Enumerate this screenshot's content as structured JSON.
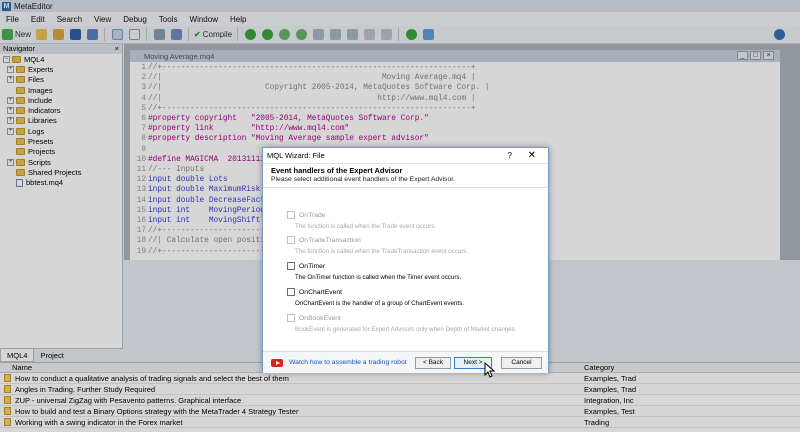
{
  "app": {
    "title": "MetaEditor"
  },
  "menu": [
    "File",
    "Edit",
    "Search",
    "View",
    "Debug",
    "Tools",
    "Window",
    "Help"
  ],
  "toolbar": {
    "new_label": "New",
    "compile_label": "Compile"
  },
  "navigator": {
    "title": "Navigator",
    "root": "MQL4",
    "items": [
      {
        "label": "Experts",
        "type": "folder",
        "expandable": true
      },
      {
        "label": "Files",
        "type": "folder",
        "expandable": true
      },
      {
        "label": "Images",
        "type": "folder",
        "expandable": false
      },
      {
        "label": "Include",
        "type": "folder",
        "expandable": true
      },
      {
        "label": "Indicators",
        "type": "folder",
        "expandable": true
      },
      {
        "label": "Libraries",
        "type": "folder",
        "expandable": true
      },
      {
        "label": "Logs",
        "type": "folder",
        "expandable": true
      },
      {
        "label": "Presets",
        "type": "folder",
        "expandable": false
      },
      {
        "label": "Projects",
        "type": "folder",
        "expandable": false
      },
      {
        "label": "Scripts",
        "type": "folder",
        "expandable": true
      },
      {
        "label": "Shared Projects",
        "type": "folder",
        "expandable": false
      },
      {
        "label": "bbtest.mq4",
        "type": "file",
        "expandable": false
      }
    ],
    "tabs": [
      "MQL4",
      "Project"
    ]
  },
  "editor": {
    "tab_title": "Moving Average.mq4",
    "lines": [
      {
        "n": "1",
        "t": "//+------------------------------------------------------------------+",
        "c": "cm"
      },
      {
        "n": "2",
        "t": "//|                                               Moving Average.mq4 |",
        "c": "cm"
      },
      {
        "n": "3",
        "t": "//|                      Copyright 2005-2014, MetaQuotes Software Corp. |",
        "c": "cm"
      },
      {
        "n": "4",
        "t": "//|                                              http://www.mql4.com |",
        "c": "cm"
      },
      {
        "n": "5",
        "t": "//+------------------------------------------------------------------+",
        "c": "cm"
      },
      {
        "n": "6",
        "t": "#property copyright   \"2005-2014, MetaQuotes Software Corp.\"",
        "c": "pp"
      },
      {
        "n": "7",
        "t": "#property link        \"http://www.mql4.com\"",
        "c": "pp"
      },
      {
        "n": "8",
        "t": "#property description \"Moving Average sample expert advisor\"",
        "c": "pp"
      },
      {
        "n": "9",
        "t": "",
        "c": ""
      },
      {
        "n": "10",
        "t": "#define MAGICMA  20131111",
        "c": "pp"
      },
      {
        "n": "11",
        "t": "//--- Inputs",
        "c": "cm"
      },
      {
        "n": "12",
        "t": "input double Lots",
        "c": "kw"
      },
      {
        "n": "13",
        "t": "input double MaximumRisk",
        "c": "kw"
      },
      {
        "n": "14",
        "t": "input double DecreaseFact",
        "c": "kw"
      },
      {
        "n": "15",
        "t": "input int    MovingPeriod",
        "c": "kw"
      },
      {
        "n": "16",
        "t": "input int    MovingShift",
        "c": "kw"
      },
      {
        "n": "17",
        "t": "//+-------------------------",
        "c": "cm"
      },
      {
        "n": "18",
        "t": "//| Calculate open positi",
        "c": "cm"
      },
      {
        "n": "19",
        "t": "//+-------------------------",
        "c": "cm"
      }
    ]
  },
  "dialog": {
    "title": "MQL Wizard: File",
    "help": "?",
    "close": "✕",
    "heading": "Event handlers of the Expert Advisor",
    "subheading": "Please select additional event handlers of the Expert Advisor.",
    "options": [
      {
        "label": "OnTrade",
        "desc": "The function is called when the Trade event occurs.",
        "enabled": false
      },
      {
        "label": "OnTradeTransaction",
        "desc": "The function is called when the TradeTransaction event occurs.",
        "enabled": false
      },
      {
        "label": "OnTimer",
        "desc": "The OnTimer function is called when the Timer event occurs.",
        "enabled": true
      },
      {
        "label": "OnChartEvent",
        "desc": "OnChartEvent is the handler of a group of ChartEvent events.",
        "enabled": true
      },
      {
        "label": "OnBookEvent",
        "desc": "BookEvent is generated for Expert Advisors only when Depth of Market changes.",
        "enabled": false
      }
    ],
    "video_link": "Watch how to assemble a trading robot",
    "back_label": "< Back",
    "next_label": "Next >",
    "cancel_label": "Cancel"
  },
  "toolbox": {
    "columns": [
      "Name",
      "Category"
    ],
    "rows": [
      {
        "name": "How to conduct a qualitative analysis of trading signals and select the best of them",
        "category": "Examples, Trad"
      },
      {
        "name": "Angles in Trading. Further Study Required",
        "category": "Examples, Trad"
      },
      {
        "name": "ZUP - universal ZigZag with Pesavento patterns. Graphical interface",
        "category": "Integration, Inc"
      },
      {
        "name": "How to build and test a Binary Options strategy with the MetaTrader 4 Strategy Tester",
        "category": "Examples, Test"
      },
      {
        "name": "Working with a swing indicator in the Forex market",
        "category": "Trading"
      }
    ]
  },
  "colors": {
    "accent": "#3a7ad6",
    "youtube": "#e32020"
  }
}
